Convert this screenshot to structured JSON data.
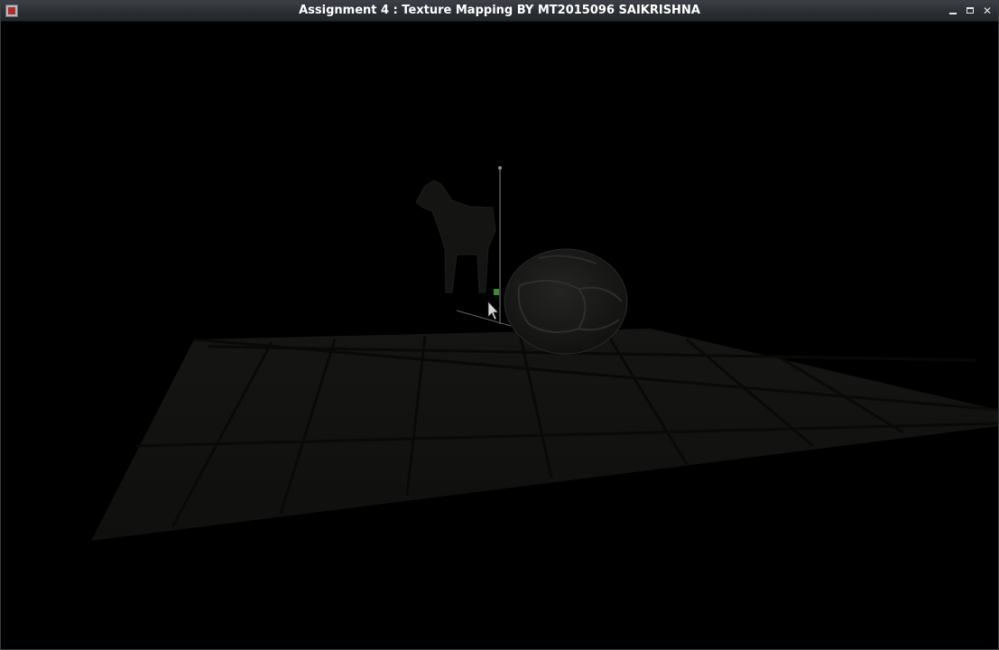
{
  "window": {
    "title": "Assignment 4 : Texture Mapping BY MT2015096 SAIKRISHNA",
    "controls": {
      "minimize_icon": "minimize-icon",
      "maximize_icon": "maximize-icon",
      "close_glyph": "✕"
    },
    "app_icon": "app-icon"
  },
  "scene": {
    "background": "#000000",
    "floor_color": "#141412",
    "object_tint": "#1b1b19",
    "axis_color": "#7a7a7a",
    "highlight_green": "#3a8c2e"
  }
}
